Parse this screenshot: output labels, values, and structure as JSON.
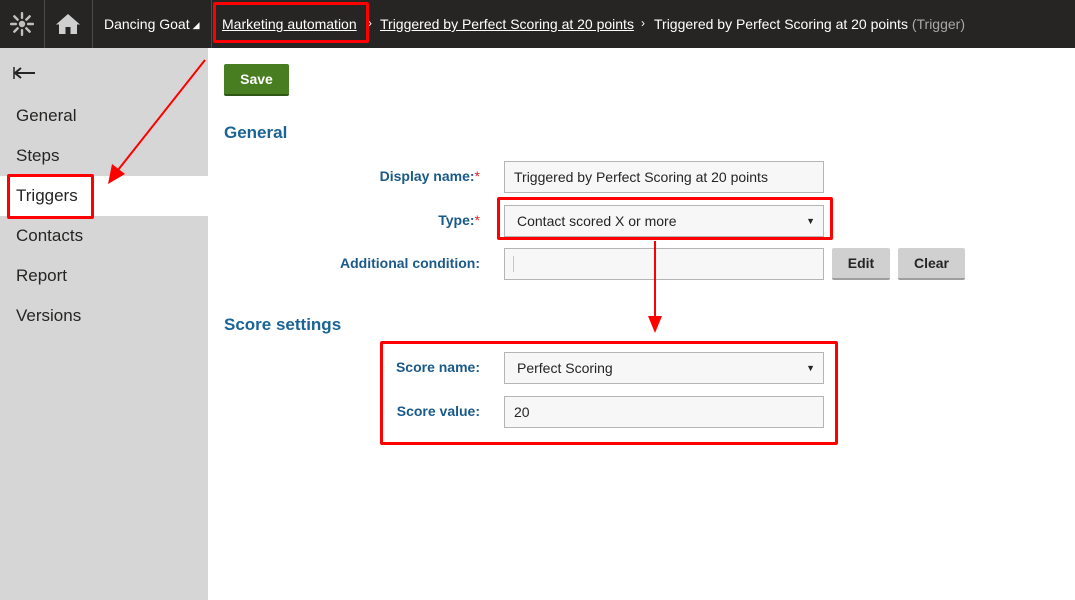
{
  "topbar": {
    "site_name": "Dancing Goat",
    "site_caret": "◢",
    "breadcrumb": [
      {
        "label": "Marketing automation"
      },
      {
        "label": "Triggered by Perfect Scoring at 20 points"
      },
      {
        "label": "Triggered by Perfect Scoring at 20 points",
        "suffix": "(Trigger)"
      }
    ],
    "separator": "›",
    "icons": [
      "kentico-logo-icon",
      "home-icon"
    ]
  },
  "sidebar": {
    "back_icon": "back-arrow-icon",
    "items": [
      {
        "label": "General"
      },
      {
        "label": "Steps"
      },
      {
        "label": "Triggers",
        "active": true
      },
      {
        "label": "Contacts"
      },
      {
        "label": "Report"
      },
      {
        "label": "Versions"
      }
    ]
  },
  "toolbar": {
    "save_label": "Save"
  },
  "general": {
    "title": "General",
    "display_name_label": "Display name:",
    "display_name_value": "Triggered by Perfect Scoring at 20 points",
    "type_label": "Type:",
    "type_value": "Contact scored X or more",
    "required_mark": "*",
    "additional_condition_label": "Additional condition:",
    "additional_condition_value": "",
    "edit_label": "Edit",
    "clear_label": "Clear"
  },
  "score_settings": {
    "title": "Score settings",
    "score_name_label": "Score name:",
    "score_name_value": "Perfect Scoring",
    "score_value_label": "Score value:",
    "score_value_value": "20"
  },
  "colors": {
    "topbar_bg": "#262524",
    "sidebar_bg": "#d6d6d6",
    "save_button": "#497d21",
    "section_title": "#1a6496",
    "highlight": "#ff0000"
  }
}
